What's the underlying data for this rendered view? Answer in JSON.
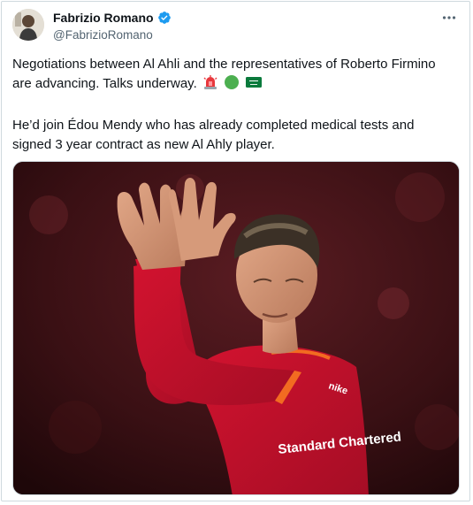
{
  "author": {
    "name": "Fabrizio Romano",
    "handle": "@FabrizioRomano",
    "verified": true,
    "avatar_icon": "profile-avatar"
  },
  "more_icon": "more-options-icon",
  "tweet": {
    "paragraph_1": "Negotiations between Al Ahli and the representatives of Roberto Firmino are advancing. Talks underway.",
    "paragraph_1_emojis": [
      "siren-emoji",
      "green-circle-emoji",
      "saudi-arabia-flag-emoji"
    ],
    "paragraph_2": "He’d join Édou Mendy who has already completed medical tests and signed 3 year contract as new Al Ahly player."
  },
  "media": {
    "kit_sponsor_text": "Standard Chartered",
    "kit_brand_text": "nike",
    "colors": {
      "shirt": "#c8102e",
      "trim": "#f26b21",
      "background": "#3a1014"
    }
  }
}
